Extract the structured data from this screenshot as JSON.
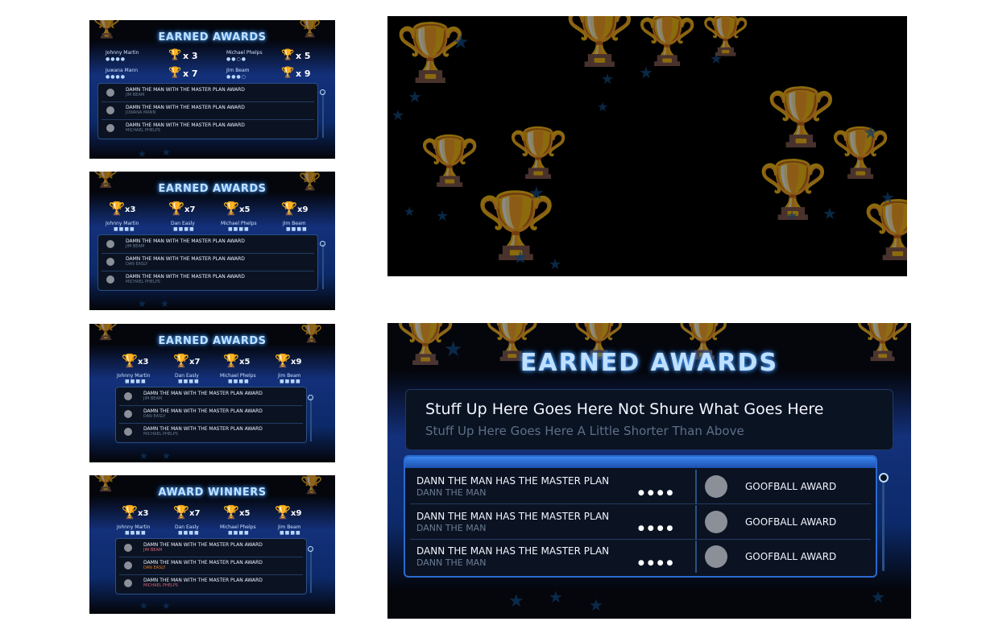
{
  "panel_a": {
    "title": "EARNED AWARDS",
    "players": [
      {
        "name": "Johnny Martin",
        "count": "x 3",
        "dots": "●●●●"
      },
      {
        "name": "Michael Phelps",
        "count": "x 5",
        "dots": "●●○●"
      },
      {
        "name": "Juwana Mann",
        "count": "x 7",
        "dots": "●●●●"
      },
      {
        "name": "Jim Beam",
        "count": "x 9",
        "dots": "●●●○"
      }
    ],
    "rows": [
      {
        "award": "DAMN THE MAN WITH THE MASTER PLAN AWARD",
        "winner": "JIM BEAM"
      },
      {
        "award": "DAMN THE MAN WITH THE MASTER PLAN AWARD",
        "winner": "JUWANA MANN"
      },
      {
        "award": "DAMN THE MAN WITH THE MASTER PLAN AWARD",
        "winner": "MICHAEL PHELPS"
      }
    ]
  },
  "panel_b": {
    "title": "EARNED AWARDS",
    "players": [
      {
        "name": "Johnny Martin",
        "count": "x3",
        "dots": "■■■■"
      },
      {
        "name": "Dan Easly",
        "count": "x7",
        "dots": "■■■■"
      },
      {
        "name": "Michael Phelps",
        "count": "x5",
        "dots": "■■■■"
      },
      {
        "name": "Jim Beam",
        "count": "x9",
        "dots": "■■■■"
      }
    ],
    "rows": [
      {
        "award": "DAMN THE MAN WITH THE MASTER PLAN AWARD",
        "winner": "JIM BEAM"
      },
      {
        "award": "DAMN THE MAN WITH THE MASTER PLAN AWARD",
        "winner": "DAN EASLY"
      },
      {
        "award": "DAMN THE MAN WITH THE MASTER PLAN AWARD",
        "winner": "MICHAEL PHELPS"
      }
    ]
  },
  "panel_c": {
    "title": "EARNED AWARDS",
    "players": [
      {
        "name": "Johnny Martin",
        "count": "x3",
        "dots": "■■■■"
      },
      {
        "name": "Dan Easly",
        "count": "x7",
        "dots": "■■■■"
      },
      {
        "name": "Michael Phelps",
        "count": "x5",
        "dots": "■■■■"
      },
      {
        "name": "Jim Beam",
        "count": "x9",
        "dots": "■■■■"
      }
    ],
    "rows": [
      {
        "award": "DAMN THE MAN WITH THE MASTER PLAN AWARD",
        "winner": "JIM BEAM"
      },
      {
        "award": "DAMN THE MAN WITH THE MASTER PLAN AWARD",
        "winner": "DAN EASLY"
      },
      {
        "award": "DAMN THE MAN WITH THE MASTER PLAN AWARD",
        "winner": "MICHAEL PHELPS"
      }
    ]
  },
  "panel_d": {
    "title": "AWARD WINNERS",
    "players": [
      {
        "name": "Johnny Martin",
        "count": "x3",
        "dots": "■■■■"
      },
      {
        "name": "Dan Easly",
        "count": "x7",
        "dots": "■■■■"
      },
      {
        "name": "Michael Phelps",
        "count": "x5",
        "dots": "■■■■"
      },
      {
        "name": "Jim Beam",
        "count": "x9",
        "dots": "■■■■"
      }
    ],
    "rows": [
      {
        "award": "DAMN THE MAN WITH THE MASTER PLAN AWARD",
        "winner": "JIM BEAM"
      },
      {
        "award": "DAMN THE MAN WITH THE MASTER PLAN AWARD",
        "winner": "DAN EASLY"
      },
      {
        "award": "DAMN THE MAN WITH THE MASTER PLAN AWARD",
        "winner": "MICHAEL PHELPS"
      }
    ]
  },
  "panel_big": {
    "title": "EARNED AWARDS",
    "headline": "Stuff Up Here Goes Here Not Shure What Goes Here",
    "subline": "Stuff Up Here Goes Here A Little Shorter Than Above",
    "rows": [
      {
        "title": "DANN THE MAN HAS THE MASTER PLAN",
        "sub": "DANN THE MAN",
        "dots": "●●●●",
        "award": "GOOFBALL AWARD"
      },
      {
        "title": "DANN THE MAN HAS THE MASTER PLAN",
        "sub": "DANN THE MAN",
        "dots": "●●●●",
        "award": "GOOFBALL AWARD"
      },
      {
        "title": "DANN THE MAN HAS THE MASTER PLAN",
        "sub": "DANN THE MAN",
        "dots": "●●●●",
        "award": "GOOFBALL AWARD"
      }
    ]
  },
  "colors": {
    "accent": "#4aa3ff",
    "trophy_gold": "#f2c12e",
    "background": "#04060c",
    "list_bg": "#0b1322"
  },
  "icons": {
    "trophy": "trophy-icon",
    "star": "star-icon",
    "award_badge": "award-badge-icon"
  }
}
